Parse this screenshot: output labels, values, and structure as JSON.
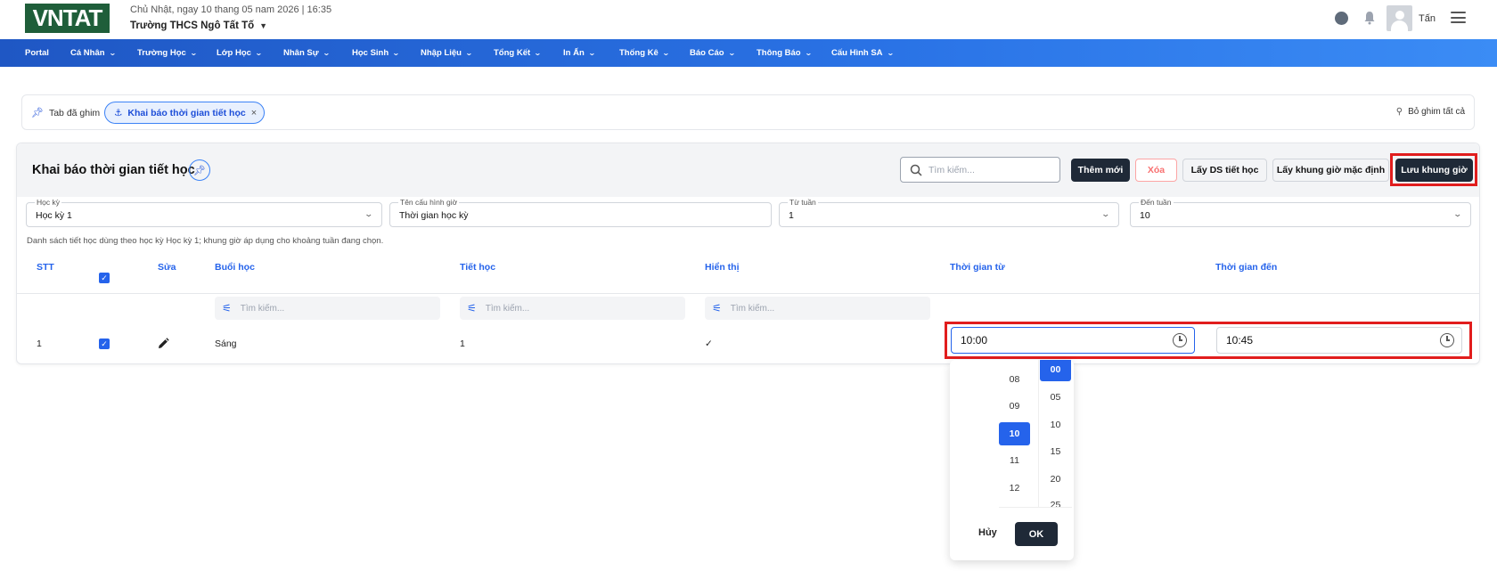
{
  "header": {
    "logo_text": "VNTAT",
    "date_line": "Chủ Nhật, ngay 10 thang 05 nam 2026 | 16:35",
    "school_name": "Trường THCS Ngô Tất Tố",
    "user_name": "Tấn"
  },
  "nav": {
    "items": [
      {
        "label": "Portal"
      },
      {
        "label": "Cá Nhân"
      },
      {
        "label": "Trường Học"
      },
      {
        "label": "Lớp Học"
      },
      {
        "label": "Nhân Sự"
      },
      {
        "label": "Học Sinh"
      },
      {
        "label": "Nhập Liệu"
      },
      {
        "label": "Tổng Kết"
      },
      {
        "label": "In Ấn"
      },
      {
        "label": "Thống Kê"
      },
      {
        "label": "Báo Cáo"
      },
      {
        "label": "Thông Báo"
      },
      {
        "label": "Cấu Hình SA"
      }
    ]
  },
  "pinned_bar": {
    "label": "Tab đã ghim",
    "chip_label": "Khai báo thời gian tiết học",
    "unpin_all": "Bỏ ghim tất cả"
  },
  "page": {
    "title": "Khai báo thời gian tiết học",
    "search_placeholder": "Tìm kiếm...",
    "btn_add": "Thêm mới",
    "btn_delete": "Xóa",
    "btn_get_periods": "Lấy DS tiết học",
    "btn_get_default": "Lấy khung giờ mặc định",
    "btn_save": "Lưu khung giờ"
  },
  "filters": {
    "semester": {
      "label": "Học kỳ",
      "value": "Học kỳ 1"
    },
    "config_name": {
      "label": "Tên cấu hình giờ",
      "value": "Thời gian học kỳ"
    },
    "from_week": {
      "label": "Từ tuần",
      "value": "1"
    },
    "to_week": {
      "label": "Đến tuần",
      "value": "10"
    }
  },
  "description": "Danh sách tiết học dùng theo học kỳ Học kỳ 1; khung giờ áp dụng cho khoảng tuần đang chọn.",
  "table": {
    "headers": {
      "stt": "STT",
      "edit": "Sửa",
      "session": "Buổi học",
      "period": "Tiết học",
      "display": "Hiển thị",
      "time_from": "Thời gian từ",
      "time_to": "Thời gian đến"
    },
    "filter_placeholder": "Tìm kiếm...",
    "rows": [
      {
        "stt": "1",
        "session": "Sáng",
        "period": "1",
        "display": "✓",
        "time_from": "10:00",
        "time_to": "10:45"
      }
    ]
  },
  "time_picker": {
    "hours": [
      "08",
      "09",
      "10",
      "11",
      "12"
    ],
    "minutes": [
      "00",
      "05",
      "10",
      "15",
      "20",
      "25"
    ],
    "selected_hour": "10",
    "selected_minute": "00",
    "cancel_label": "Hủy",
    "ok_label": "OK"
  },
  "colors": {
    "primary": "#2563eb",
    "dark_button": "#1f2937",
    "highlight_red": "#e11d1d",
    "logo_green": "#1f5e3a"
  }
}
